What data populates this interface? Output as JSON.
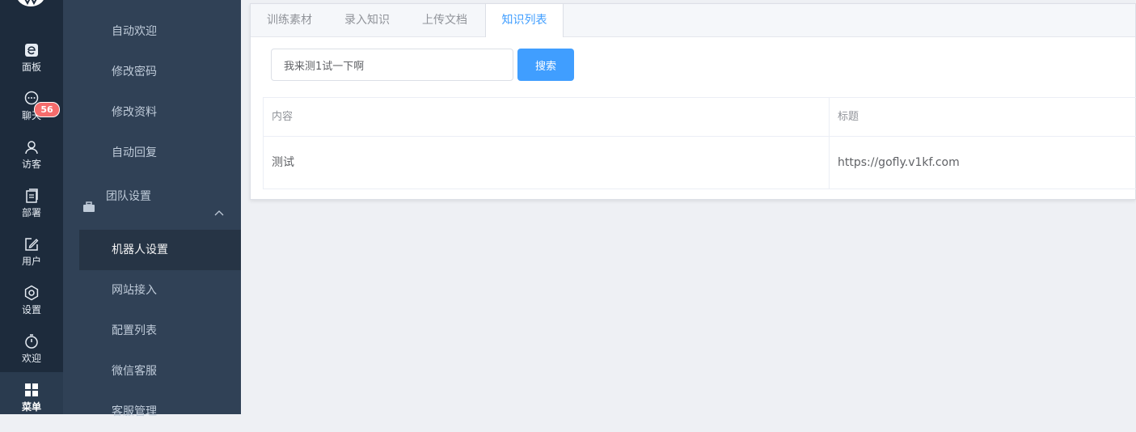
{
  "rail": {
    "items": [
      {
        "label": "面板",
        "icon": "dashboard-icon"
      },
      {
        "label": "聊天",
        "icon": "chat-icon",
        "badge": "56"
      },
      {
        "label": "访客",
        "icon": "user-icon"
      },
      {
        "label": "部署",
        "icon": "deploy-icon"
      },
      {
        "label": "用户",
        "icon": "edit-icon"
      },
      {
        "label": "设置",
        "icon": "gear-icon"
      },
      {
        "label": "欢迎",
        "icon": "timer-icon"
      },
      {
        "label": "菜单",
        "icon": "grid-icon"
      }
    ]
  },
  "subnav": {
    "items_top": [
      "自动欢迎",
      "修改密码",
      "修改资料",
      "自动回复"
    ],
    "group": {
      "label": "团队设置",
      "icon": "briefcase-icon"
    },
    "items_group": [
      "机器人设置",
      "网站接入",
      "配置列表",
      "微信客服",
      "客服管理"
    ]
  },
  "tabs": [
    "训练素材",
    "录入知识",
    "上传文档",
    "知识列表"
  ],
  "search": {
    "value": "我来测1试一下啊",
    "button": "搜索"
  },
  "table": {
    "headers": [
      "内容",
      "标题"
    ],
    "rows": [
      [
        "测试",
        "https://gofly.v1kf.com"
      ]
    ]
  },
  "colors": {
    "accent": "#409eff",
    "rail_bg": "#1d2b3c",
    "subnav_bg": "#304156",
    "badge": "#f56c6c"
  }
}
